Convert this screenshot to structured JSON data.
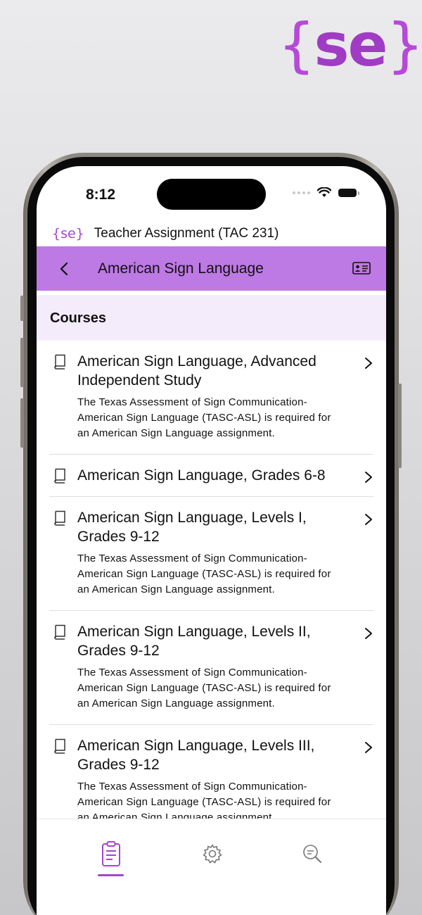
{
  "brand": {
    "logo_open": "{",
    "logo_word": "se",
    "logo_close": "}"
  },
  "status_bar": {
    "time": "8:12"
  },
  "app_header": {
    "logo": "{se}",
    "title": "Teacher Assignment (TAC 231)"
  },
  "navbar": {
    "title": "American Sign Language"
  },
  "section": {
    "title": "Courses"
  },
  "courses": [
    {
      "title": "American Sign Language, Advanced Independent Study",
      "description": "The Texas Assessment of Sign Communication-American Sign Language (TASC-ASL) is required for an American Sign Language assignment."
    },
    {
      "title": "American Sign Language, Grades 6-8",
      "description": ""
    },
    {
      "title": "American Sign Language, Levels I, Grades 9-12",
      "description": "The Texas Assessment of Sign Communication-American Sign Language (TASC-ASL) is required for an American Sign Language assignment."
    },
    {
      "title": "American Sign Language, Levels II, Grades 9-12",
      "description": "The Texas Assessment of Sign Communication-American Sign Language (TASC-ASL) is required for an American Sign Language assignment."
    },
    {
      "title": "American Sign Language, Levels III, Grades 9-12",
      "description": "The Texas Assessment of Sign Communication-American Sign Language (TASC-ASL) is required for an American Sign Language assignment."
    }
  ],
  "tabbar": {
    "tabs": [
      {
        "icon": "clipboard-icon",
        "active": true
      },
      {
        "icon": "gear-icon",
        "active": false
      },
      {
        "icon": "search-document-icon",
        "active": false
      }
    ]
  },
  "colors": {
    "accent": "#a447c9",
    "navbar": "#bd79e4",
    "section_bg": "#f5ecfb"
  }
}
